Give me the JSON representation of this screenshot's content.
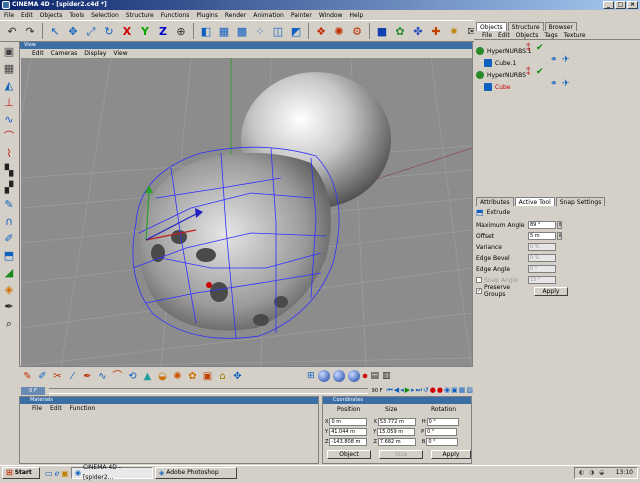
{
  "window": {
    "title": "CINEMA 4D - [spider2.c4d *]"
  },
  "menubar": [
    "File",
    "Edit",
    "Objects",
    "Tools",
    "Selection",
    "Structure",
    "Functions",
    "Plugins",
    "Render",
    "Animation",
    "Painter",
    "Window",
    "Help"
  ],
  "toolbar_icons": [
    "undo-icon",
    "redo-icon",
    "live-select-icon",
    "move-icon",
    "scale-icon",
    "rotate-icon",
    "axis-x-icon",
    "axis-y-icon",
    "axis-z-icon",
    "coordinate-system-icon",
    "model-mode-icon",
    "object-mode-icon",
    "texture-mode-icon",
    "points-mode-icon",
    "edges-mode-icon",
    "polygons-mode-icon",
    "render-view-icon",
    "render-picture-icon",
    "render-settings-icon",
    "primitive-cube-icon",
    "nurbs-icon",
    "deformer-icon",
    "scene-icon",
    "light-icon",
    "camera-icon",
    "sky-icon"
  ],
  "left_tools": [
    "snap-icon",
    "grid-icon",
    "camera-icon",
    "axis-icon",
    "spline-icon",
    "bezier-icon",
    "knife-icon",
    "checker-icon",
    "checker2-icon",
    "brush-icon",
    "magnet-icon",
    "paint-icon",
    "extrude-icon",
    "bevel-icon",
    "layers-icon",
    "tool-icon"
  ],
  "viewport": {
    "title": "View",
    "menu": [
      "Edit",
      "Cameras",
      "Display",
      "View"
    ]
  },
  "object_manager": {
    "tabs": [
      "Objects",
      "Structure",
      "Browser"
    ],
    "active_tab": "Objects",
    "menu": [
      "File",
      "Edit",
      "Objects",
      "Tags",
      "Texture"
    ],
    "objects": [
      {
        "name": "HyperNURBS.1",
        "color": "#000000",
        "level": 0
      },
      {
        "name": "Cube.1",
        "color": "#000000",
        "level": 1
      },
      {
        "name": "HyperNURBS",
        "color": "#000000",
        "level": 0
      },
      {
        "name": "Cube",
        "color": "#cc0000",
        "level": 1
      }
    ]
  },
  "attributes": {
    "tabs": [
      "Attributes",
      "Active Tool",
      "Snap Settings"
    ],
    "active_tab": "Active Tool",
    "tool_name": "Extrude",
    "fields": [
      {
        "label": "Maximum Angle",
        "value": "89 °",
        "enabled": true
      },
      {
        "label": "Offset",
        "value": "5 m",
        "enabled": true
      },
      {
        "label": "Variance",
        "value": "0 %",
        "enabled": false
      },
      {
        "label": "Edge Bevel",
        "value": "0 %",
        "enabled": false
      },
      {
        "label": "Edge Angle",
        "value": "0 °",
        "enabled": false
      },
      {
        "label": "Snap Angle",
        "value": "15 °",
        "enabled": false
      }
    ],
    "snap_angle_checked": false,
    "preserve_groups_label": "Preserve Groups",
    "preserve_groups_checked": true,
    "apply_label": "Apply"
  },
  "timeline": {
    "current_frame": "0 F",
    "end_label": "90 F"
  },
  "materials": {
    "title": "Materials",
    "menu": [
      "File",
      "Edit",
      "Function"
    ]
  },
  "coordinates": {
    "title": "Coordinates",
    "headers": [
      "Position",
      "Size",
      "Rotation"
    ],
    "rows": [
      {
        "pos_axis": "X",
        "pos": "0 m",
        "size_axis": "X",
        "size": "53.772 m",
        "rot_axis": "H",
        "rot": "0 °"
      },
      {
        "pos_axis": "Y",
        "pos": "41.044 m",
        "size_axis": "Y",
        "size": "15.059 m",
        "rot_axis": "P",
        "rot": "0 °"
      },
      {
        "pos_axis": "Z",
        "pos": "-143.808 m",
        "size_axis": "Z",
        "size": "7.682 m",
        "rot_axis": "B",
        "rot": "0 °"
      }
    ],
    "mode_select": "Object",
    "size_select": "Size",
    "apply_label": "Apply"
  },
  "taskbar": {
    "start_label": "Start",
    "tasks": [
      {
        "label": "CINEMA 4D - [spider2...",
        "active": true
      },
      {
        "label": "Adobe Photoshop",
        "active": false
      }
    ],
    "clock": "13:10"
  },
  "colors": {
    "wireframe": "#3030ff",
    "title_bar": "#0a246a",
    "panel_title": "#3a6ea5",
    "viewport_bg": "#8c8c8c"
  }
}
